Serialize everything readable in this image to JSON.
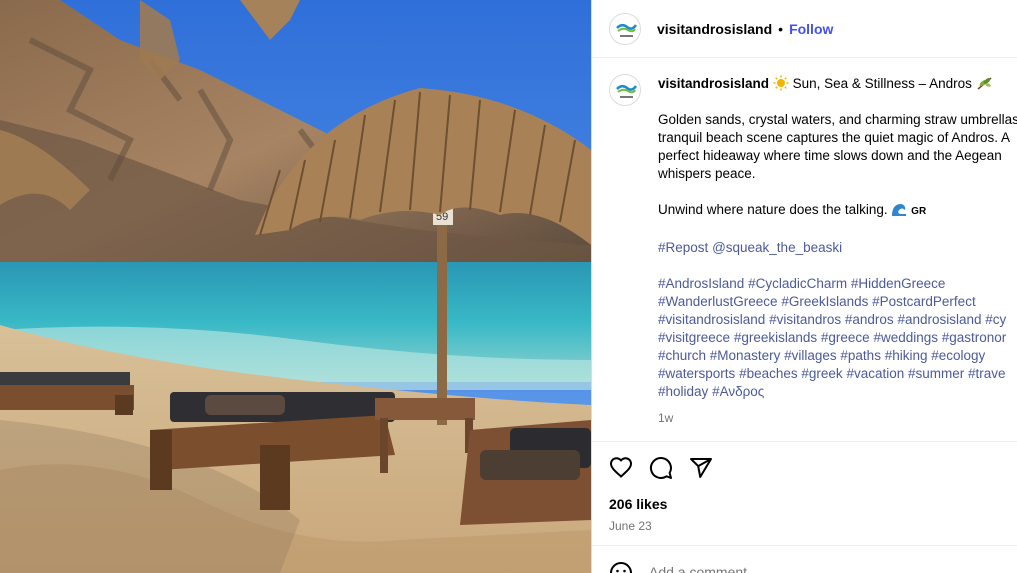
{
  "post": {
    "username": "visitandrosisland",
    "follow_label": "Follow",
    "separator": "•",
    "caption": {
      "title": "Sun, Sea & Stillness – Andros",
      "lines": [
        "Golden sands, crystal waters, and charming straw umbrellas",
        "tranquil beach scene captures the quiet magic of Andros. A",
        "perfect hideaway where time slows down and the Aegean",
        "whispers peace."
      ],
      "unwind": "Unwind where nature does the talking.",
      "flag_text": "GR",
      "repost_tag": "#Repost",
      "repost_user": "@squeak_the_beaski",
      "hashtag_lines": [
        [
          "#AndrosIsland",
          "#CycladicCharm",
          "#HiddenGreece"
        ],
        [
          "#WanderlustGreece",
          "#GreekIslands",
          "#PostcardPerfect"
        ],
        [
          "#visitandrosisland",
          "#visitandros",
          "#andros",
          "#androsisland",
          "#cy"
        ],
        [
          "#visitgreece",
          "#greekislands",
          "#greece",
          "#weddings",
          "#gastronor"
        ],
        [
          "#church",
          "#Monastery",
          "#villages",
          "#paths",
          "#hiking",
          "#ecology"
        ],
        [
          "#watersports",
          "#beaches",
          "#greek",
          "#vacation",
          "#summer",
          "#trave"
        ],
        [
          "#holiday",
          "#Ανδρος"
        ]
      ],
      "time_ago": "1w"
    },
    "likes": "206 likes",
    "date": "June 23",
    "comment_placeholder": "Add a comment...",
    "umbrella_number": "59",
    "icons": [
      "heart-icon",
      "comment-icon",
      "share-icon",
      "emoji-icon"
    ],
    "colors": {
      "link": "#4150f7",
      "hashtag": "#4c5a9b",
      "muted": "#737373"
    }
  }
}
